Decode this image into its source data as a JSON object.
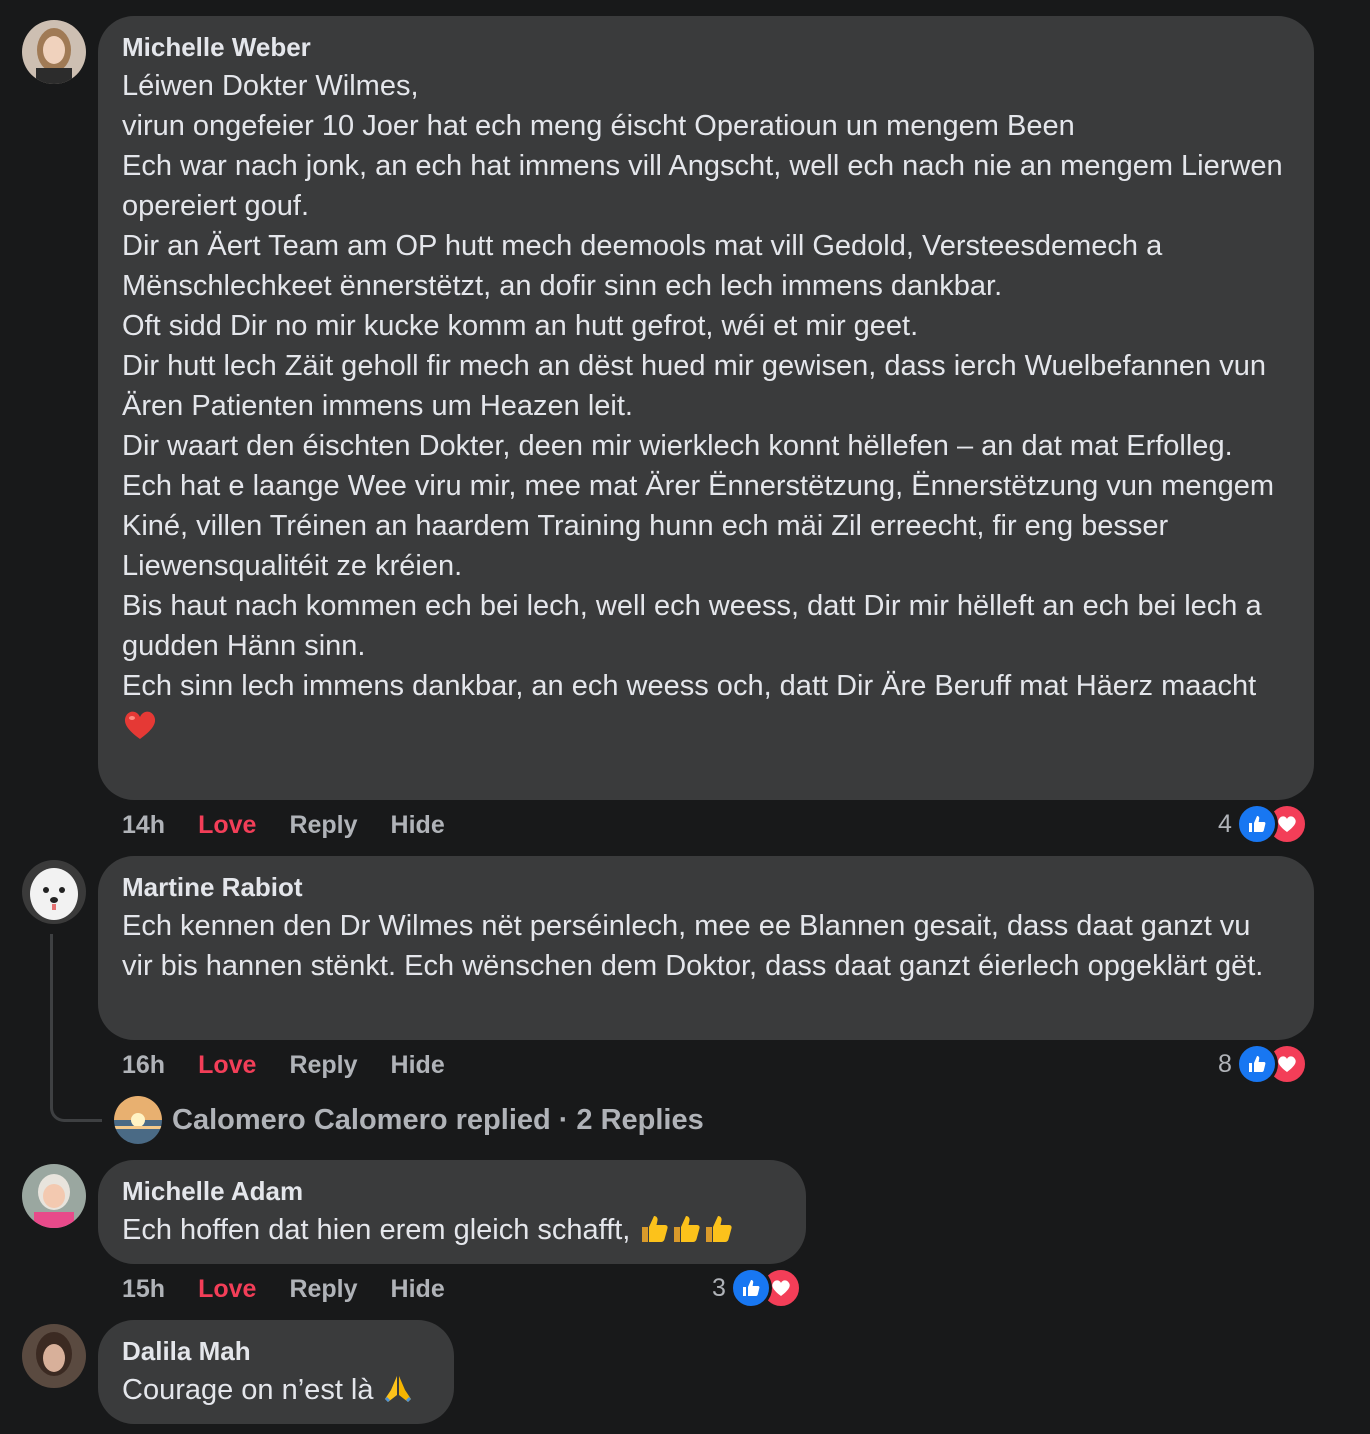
{
  "comments": [
    {
      "author": "Michelle Weber",
      "text": "Léiwen Dokter Wilmes,\nvirun ongefeier 10 Joer hat ech meng éischt Operatioun un mengem Been\nEch war nach jonk, an ech hat immens vill Angscht, well ech nach nie an mengem Lierwen opereiert gouf.\nDir an Äert Team am OP hutt mech deemools mat vill Gedold, Versteesdemech a Mënschlechkeet ënnerstëtzt, an dofir sinn ech lech immens dankbar.\nOft sidd Dir no mir kucke komm an hutt gefrot, wéi et mir geet.\nDir hutt lech Zäit geholl fir mech an dëst hued mir gewisen, dass ierch Wuelbefannen vun Ären Patienten immens um Heazen leit.\nDir waart den éischten Dokter, deen mir wierklech konnt hëllefen – an dat mat Erfolleg.\nEch hat e laange Wee viru mir, mee mat Ärer Ënnerstëtzung, Ënnerstëtzung vun mengem Kiné, villen Tréinen an haardem Training hunn ech mäi Zil erreecht, fir eng besser Liewensqualitéit ze kréien.\nBis haut nach kommen ech bei lech, well ech weess, datt Dir mir hëlleft an ech bei lech a gudden Hänn sinn.\nEch sinn lech immens dankbar, an ech weess och, datt Dir Äre Beruff mat Häerz maacht",
      "time": "14h",
      "love": "Love",
      "reply": "Reply",
      "hide": "Hide",
      "reaction_count": "4"
    },
    {
      "author": "Martine Rabiot",
      "text": "Ech kennen den Dr Wilmes nët perséinlech, mee ee Blannen gesait, dass daat ganzt vu vir bis hannen stënkt. Ech wënschen dem Doktor, dass daat ganzt éierlech opgeklärt gët.",
      "time": "16h",
      "love": "Love",
      "reply": "Reply",
      "hide": "Hide",
      "reaction_count": "8",
      "replies": {
        "replier": "Calomero Calomero replied",
        "separator": "·",
        "count": "2 Replies"
      }
    },
    {
      "author": "Michelle Adam",
      "text": "Ech hoffen dat hien erem gleich schafft,",
      "time": "15h",
      "love": "Love",
      "reply": "Reply",
      "hide": "Hide",
      "reaction_count": "3"
    },
    {
      "author": "Dalila Mah",
      "text": "Courage on n’est là"
    }
  ],
  "colors": {
    "background": "#18191a",
    "bubble": "#3a3b3c",
    "love_active": "#f33e58",
    "like_blue": "#1877f2",
    "muted_text": "#b0b3b8"
  },
  "icons": [
    "like-icon",
    "love-icon",
    "heart-emoji",
    "thumbs-up-emoji",
    "folded-hands-emoji"
  ]
}
